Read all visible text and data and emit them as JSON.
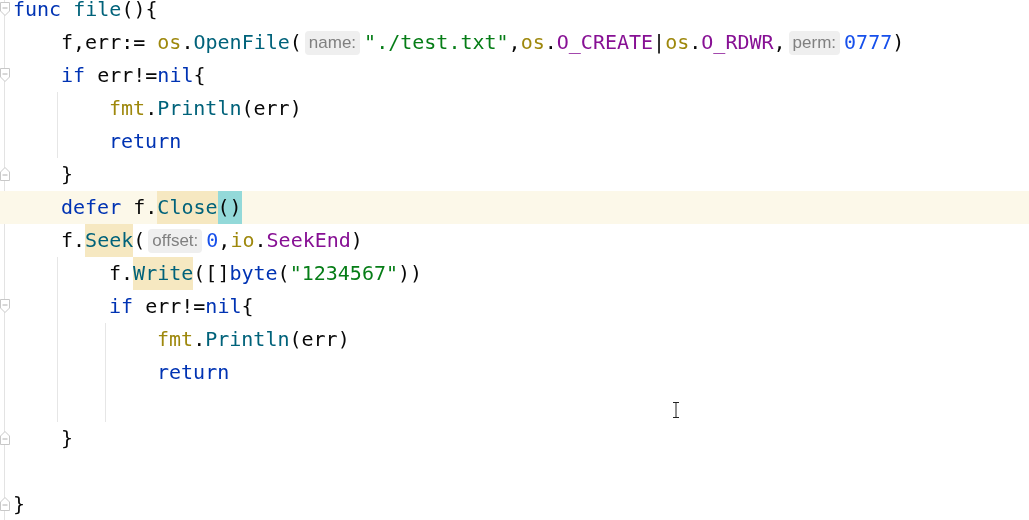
{
  "editor": {
    "lines": [
      {
        "fold_start": true,
        "current": false,
        "tokens": [
          {
            "kind": "keyword",
            "text": "func "
          },
          {
            "kind": "function",
            "text": "file"
          },
          {
            "kind": "plain",
            "text": "(){"
          }
        ],
        "children": [
          {
            "current": false,
            "tokens": [
              {
                "kind": "plain",
                "text": "f,err:= "
              },
              {
                "kind": "package",
                "text": "os"
              },
              {
                "kind": "plain",
                "text": "."
              },
              {
                "kind": "function",
                "text": "OpenFile"
              },
              {
                "kind": "plain",
                "text": "("
              },
              {
                "kind": "hint",
                "text": "name:"
              },
              {
                "kind": "string",
                "text": "\"./test.txt\""
              },
              {
                "kind": "plain",
                "text": ","
              },
              {
                "kind": "package",
                "text": "os"
              },
              {
                "kind": "plain",
                "text": "."
              },
              {
                "kind": "constant",
                "text": "O_CREATE"
              },
              {
                "kind": "plain",
                "text": "|"
              },
              {
                "kind": "package",
                "text": "os"
              },
              {
                "kind": "plain",
                "text": "."
              },
              {
                "kind": "constant",
                "text": "O_RDWR"
              },
              {
                "kind": "plain",
                "text": ","
              },
              {
                "kind": "hint",
                "text": "perm:"
              },
              {
                "kind": "number",
                "text": "0777"
              },
              {
                "kind": "plain",
                "text": ")"
              }
            ]
          },
          {
            "fold_start": true,
            "current": false,
            "tokens": [
              {
                "kind": "keyword",
                "text": "if"
              },
              {
                "kind": "plain",
                "text": " err!="
              },
              {
                "kind": "keyword",
                "text": "nil"
              },
              {
                "kind": "plain",
                "text": "{"
              }
            ],
            "children": [
              {
                "current": false,
                "tokens": [
                  {
                    "kind": "package",
                    "text": "fmt"
                  },
                  {
                    "kind": "plain",
                    "text": "."
                  },
                  {
                    "kind": "function",
                    "text": "Println"
                  },
                  {
                    "kind": "plain",
                    "text": "(err)"
                  }
                ]
              },
              {
                "current": false,
                "tokens": [
                  {
                    "kind": "keyword",
                    "text": "return"
                  }
                ]
              }
            ]
          },
          {
            "fold_end": true,
            "current": false,
            "tokens": [
              {
                "kind": "plain",
                "text": "}"
              }
            ]
          },
          {
            "current": true,
            "tokens": [
              {
                "kind": "keyword",
                "text": "defer"
              },
              {
                "kind": "plain",
                "text": " f."
              },
              {
                "kind": "function",
                "text": "Close",
                "usage_highlight": true
              },
              {
                "kind": "plain",
                "text": "()",
                "brace_match": true
              }
            ]
          },
          {
            "current": false,
            "tokens": [
              {
                "kind": "plain",
                "text": "f."
              },
              {
                "kind": "function",
                "text": "Seek",
                "usage_highlight": true
              },
              {
                "kind": "plain",
                "text": "("
              },
              {
                "kind": "hint",
                "text": "offset:"
              },
              {
                "kind": "number",
                "text": "0"
              },
              {
                "kind": "plain",
                "text": ","
              },
              {
                "kind": "package",
                "text": "io"
              },
              {
                "kind": "plain",
                "text": "."
              },
              {
                "kind": "constant",
                "text": "SeekEnd"
              },
              {
                "kind": "plain",
                "text": ")"
              }
            ],
            "children": [
              {
                "current": false,
                "tokens": [
                  {
                    "kind": "plain",
                    "text": "f."
                  },
                  {
                    "kind": "function",
                    "text": "Write",
                    "usage_highlight": true
                  },
                  {
                    "kind": "plain",
                    "text": "([]"
                  },
                  {
                    "kind": "keyword",
                    "text": "byte"
                  },
                  {
                    "kind": "plain",
                    "text": "("
                  },
                  {
                    "kind": "string",
                    "text": "\"1234567\""
                  },
                  {
                    "kind": "plain",
                    "text": "))"
                  }
                ]
              },
              {
                "fold_start": true,
                "current": false,
                "tokens": [
                  {
                    "kind": "keyword",
                    "text": "if"
                  },
                  {
                    "kind": "plain",
                    "text": " err!="
                  },
                  {
                    "kind": "keyword",
                    "text": "nil"
                  },
                  {
                    "kind": "plain",
                    "text": "{"
                  }
                ],
                "children": [
                  {
                    "current": false,
                    "tokens": [
                      {
                        "kind": "package",
                        "text": "fmt"
                      },
                      {
                        "kind": "plain",
                        "text": "."
                      },
                      {
                        "kind": "function",
                        "text": "Println"
                      },
                      {
                        "kind": "plain",
                        "text": "(err)"
                      }
                    ]
                  },
                  {
                    "current": false,
                    "tokens": [
                      {
                        "kind": "keyword",
                        "text": "return"
                      }
                    ]
                  },
                  {
                    "current": false
                  }
                ]
              }
            ]
          },
          {
            "fold_end": true,
            "current": false,
            "tokens": [
              {
                "kind": "plain",
                "text": "}"
              }
            ]
          }
        ]
      },
      {
        "current": false
      },
      {
        "fold_end": true,
        "current": false,
        "tokens": [
          {
            "kind": "plain",
            "text": "}"
          }
        ]
      }
    ]
  }
}
